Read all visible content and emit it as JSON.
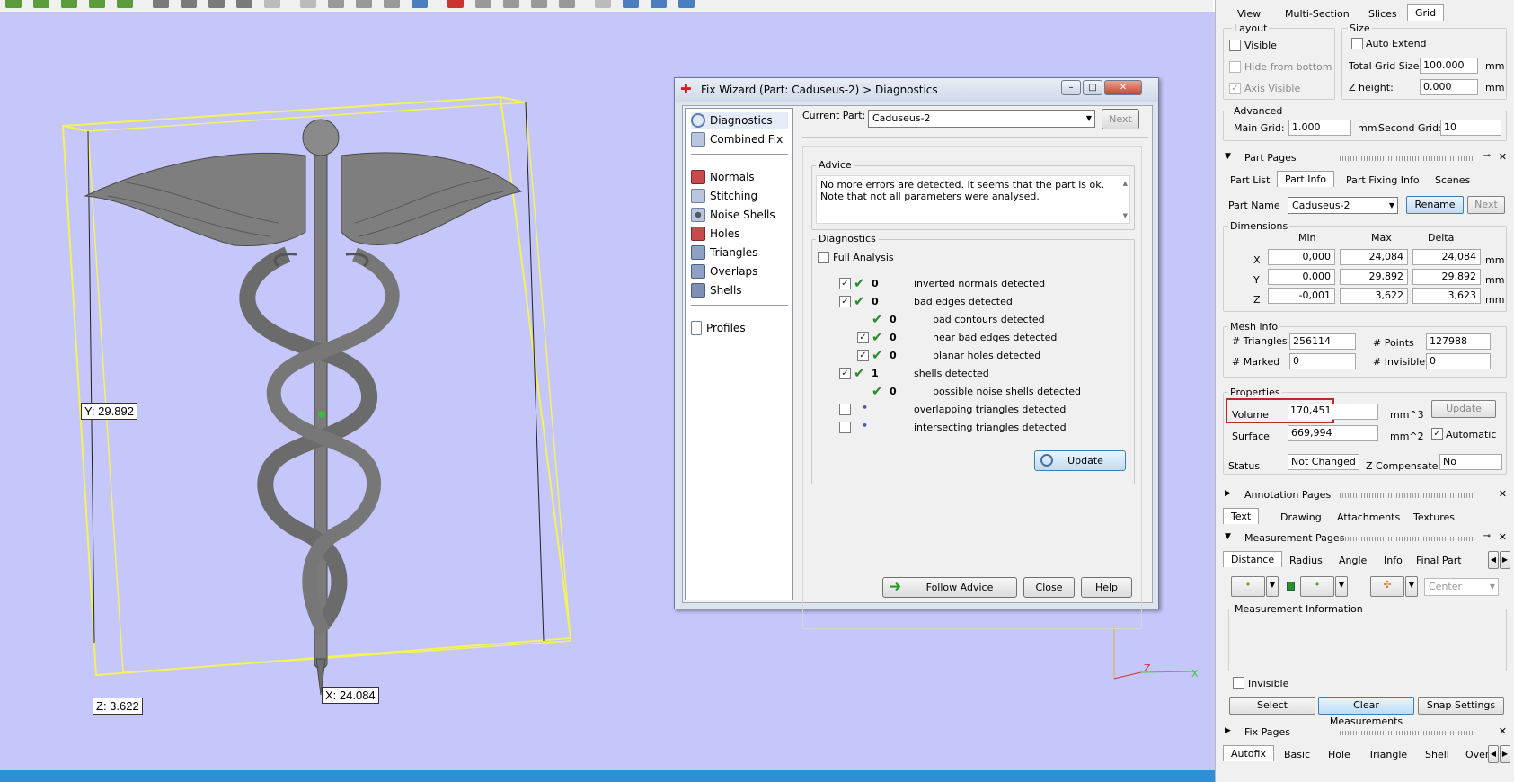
{
  "viewport": {
    "dim_y": "Y: 29.892",
    "dim_z": "Z: 3.622",
    "dim_x": "X: 24.084",
    "axis_z": "Z",
    "axis_x": "X"
  },
  "dialog": {
    "title": "Fix Wizard (Part: Caduseus-2) > Diagnostics",
    "nav": {
      "diagnostics": "Diagnostics",
      "combined_fix": "Combined Fix",
      "normals": "Normals",
      "stitching": "Stitching",
      "noise_shells": "Noise Shells",
      "holes": "Holes",
      "triangles": "Triangles",
      "overlaps": "Overlaps",
      "shells": "Shells",
      "profiles": "Profiles"
    },
    "current_part_label": "Current Part:",
    "current_part_value": "Caduseus-2",
    "next_label": "Next",
    "advice_title": "Advice",
    "advice_text": "No more errors are detected. It seems that the part is ok. Note that not all parameters were analysed.",
    "diagnostics_title": "Diagnostics",
    "full_analysis_label": "Full Analysis",
    "rows": [
      {
        "count": "0",
        "label": "inverted normals detected"
      },
      {
        "count": "0",
        "label": "bad edges detected"
      },
      {
        "count": "0",
        "label": "bad contours detected"
      },
      {
        "count": "0",
        "label": "near bad edges detected"
      },
      {
        "count": "0",
        "label": "planar holes detected"
      },
      {
        "count": "1",
        "label": "shells detected"
      },
      {
        "count": "0",
        "label": "possible noise shells detected"
      },
      {
        "count": "",
        "label": "overlapping triangles detected"
      },
      {
        "count": "",
        "label": "intersecting triangles detected"
      }
    ],
    "update_label": "Update",
    "follow_advice_label": "Follow Advice",
    "close_label": "Close",
    "help_label": "Help"
  },
  "panel": {
    "top_tabs": [
      "View",
      "Multi-Section",
      "Slices",
      "Grid"
    ],
    "layout_title": "Layout",
    "visible_label": "Visible",
    "hide_bottom_label": "Hide from bottom",
    "axis_visible_label": "Axis Visible",
    "size_title": "Size",
    "auto_extend_label": "Auto Extend",
    "total_grid_label": "Total Grid Size:",
    "total_grid_value": "100.000",
    "z_height_label": "Z height:",
    "z_height_value": "0.000",
    "mm": "mm",
    "advanced_title": "Advanced",
    "main_grid_label": "Main Grid:",
    "main_grid_value": "1.000",
    "second_grid_label": "Second Grid:",
    "second_grid_value": "10",
    "part_pages_title": "Part Pages",
    "part_tabs": [
      "Part List",
      "Part Info",
      "Part Fixing Info",
      "Scenes"
    ],
    "part_name_label": "Part Name",
    "part_name_value": "Caduseus-2",
    "rename_label": "Rename",
    "next_label": "Next",
    "dimensions_title": "Dimensions",
    "dim_headers": [
      "Min",
      "Max",
      "Delta"
    ],
    "dims": [
      {
        "axis": "X",
        "min": "0,000",
        "max": "24,084",
        "delta": "24,084"
      },
      {
        "axis": "Y",
        "min": "0,000",
        "max": "29,892",
        "delta": "29,892"
      },
      {
        "axis": "Z",
        "min": "-0,001",
        "max": "3,622",
        "delta": "3,623"
      }
    ],
    "mesh_info_title": "Mesh info",
    "triangles_label": "# Triangles",
    "triangles_value": "256114",
    "points_label": "# Points",
    "points_value": "127988",
    "marked_label": "# Marked",
    "marked_value": "0",
    "invisible_label": "# Invisible",
    "invisible_value": "0",
    "properties_title": "Properties",
    "volume_label": "Volume",
    "volume_value": "170,451",
    "volume_unit": "mm^3",
    "update_label": "Update",
    "surface_label": "Surface",
    "surface_value": "669,994",
    "surface_unit": "mm^2",
    "automatic_label": "Automatic",
    "status_label": "Status",
    "status_value": "Not Changed",
    "zcomp_label": "Z Compensated",
    "zcomp_value": "No",
    "annotation_title": "Annotation Pages",
    "annotation_tabs": [
      "Text",
      "Drawing",
      "Attachments",
      "Textures"
    ],
    "measurement_title": "Measurement Pages",
    "measurement_tabs": [
      "Distance",
      "Radius",
      "Angle",
      "Info",
      "Final Part"
    ],
    "center_label": "Center",
    "measurement_info_title": "Measurement Information",
    "meas_invisible_label": "Invisible",
    "select_label": "Select",
    "clear_label": "Clear Measurements",
    "snap_label": "Snap Settings",
    "fix_pages_title": "Fix Pages",
    "fix_tabs": [
      "Autofix",
      "Basic",
      "Hole",
      "Triangle",
      "Shell",
      "Over"
    ]
  },
  "colors": {
    "viewport_bg": "#c5c6fa",
    "bbox_yellow": "#f4f25a",
    "highlight_red": "#c0272d",
    "check_green": "#2b8b2b"
  }
}
